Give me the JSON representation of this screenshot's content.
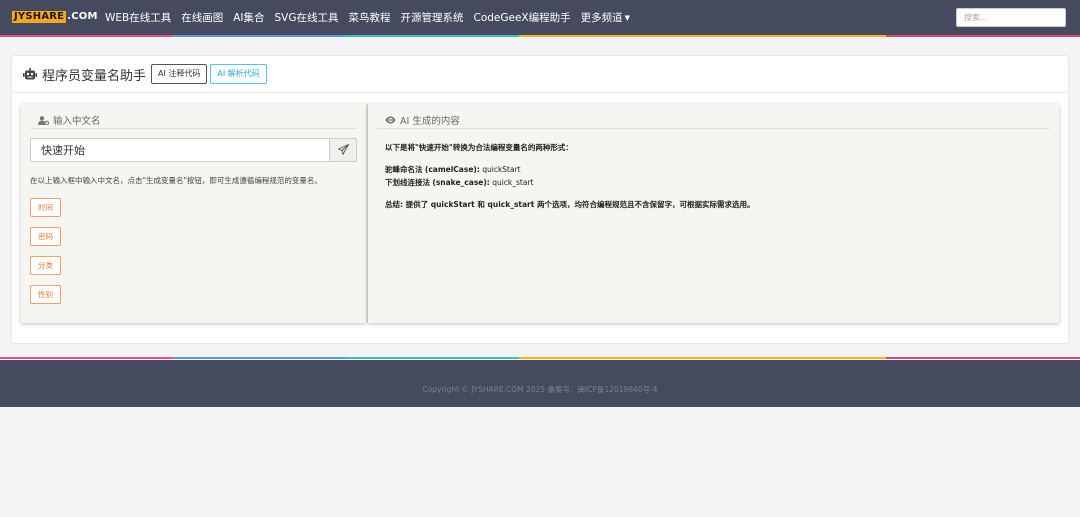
{
  "brand": {
    "logo_box": "JYSHARE",
    "logo_rest": ".COM"
  },
  "nav": {
    "items": [
      "WEB在线工具",
      "在线画图",
      "AI集合",
      "SVG在线工具",
      "菜鸟教程",
      "开源管理系统",
      "CodeGeeX编程助手",
      "更多频道"
    ],
    "search_placeholder": "搜索..."
  },
  "header": {
    "title": "程序员变量名助手",
    "btn_comment": "AI 注释代码",
    "btn_parse": "AI 解析代码"
  },
  "left": {
    "title": "输入中文名",
    "input_value": "快速开始",
    "hint": "在以上输入框中输入中文名，点击\"生成变量名\"按钮，即可生成遵循编程规范的变量名。",
    "tags": [
      "时间",
      "密码",
      "分类",
      "性别"
    ]
  },
  "right": {
    "title": "AI 生成的内容",
    "intro": "以下是将\"快速开始\"转换为合法编程变量名的两种形式：",
    "camel_label": "驼峰命名法",
    "camel_key": "(camelCase):",
    "camel_value": "quickStart",
    "snake_label": "下划线连接法",
    "snake_key": "(snake_case):",
    "snake_value": "quick_start",
    "summary": "总结: 提供了 quickStart 和 quick_start 两个选项，均符合编程规范且不含保留字，可根据实际需求选用。"
  },
  "footer": {
    "text": "Copyright © JYSHARE.COM 2025 备案号：闽ICP备12019840号-4"
  },
  "colors": {
    "navbar": "#454a5e",
    "stripe": [
      "#e0508b",
      "#5b9bd5",
      "#3fc1b0",
      "#f0b429",
      "#d64a6a"
    ],
    "tag_accent": "#e8783a",
    "info_button": "#31a7cf"
  },
  "icons": {
    "robot": "robot-icon",
    "user": "user-cog-icon",
    "send": "paper-plane-icon",
    "eye": "eye-icon",
    "caret": "caret-down-icon"
  }
}
